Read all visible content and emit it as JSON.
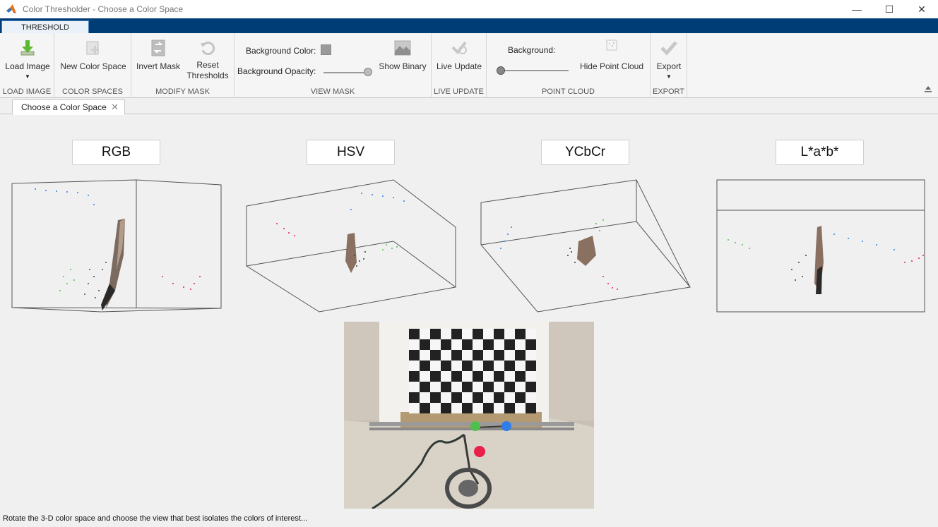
{
  "window": {
    "title": "Color Thresholder - Choose a Color Space",
    "controls": {
      "minimize": "—",
      "maximize": "☐",
      "close": "✕"
    }
  },
  "ribbon": {
    "tab": "THRESHOLD",
    "sections": {
      "load_image": {
        "label": "LOAD IMAGE",
        "button": "Load Image"
      },
      "color_spaces": {
        "label": "COLOR SPACES",
        "button": "New Color Space"
      },
      "modify_mask": {
        "label": "MODIFY MASK",
        "invert": "Invert Mask",
        "reset_line1": "Reset",
        "reset_line2": "Thresholds"
      },
      "view_mask": {
        "label": "VIEW MASK",
        "bg_color": "Background Color:",
        "bg_opacity": "Background Opacity:",
        "show_binary": "Show Binary"
      },
      "live_update": {
        "label": "LIVE UPDATE",
        "button": "Live Update"
      },
      "point_cloud": {
        "label": "POINT CLOUD",
        "background": "Background:",
        "hide": "Hide Point Cloud"
      },
      "export": {
        "label": "EXPORT",
        "button": "Export"
      }
    }
  },
  "document_tab": {
    "label": "Choose a Color Space",
    "close": "✕"
  },
  "color_spaces": [
    "RGB",
    "HSV",
    "YCbCr",
    "L*a*b*"
  ],
  "status": "Rotate the 3-D color space and choose the view that best isolates the colors of interest...",
  "colors": {
    "ribbon_bar": "#003c75",
    "tab_border": "#4c86c0",
    "red": "#e8204a",
    "green": "#4fc04f",
    "blue": "#2f7ee8"
  }
}
